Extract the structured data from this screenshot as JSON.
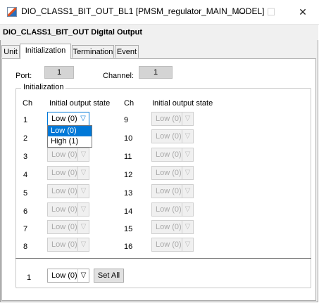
{
  "window": {
    "title": "DIO_CLASS1_BIT_OUT_BL1  [PMSM_regulator_MAIN_MODEL]",
    "controls": {
      "minimize": "—",
      "maximize": "☐",
      "close": "✕"
    }
  },
  "header": {
    "title": "DIO_CLASS1_BIT_OUT  Digital Output"
  },
  "tabs": [
    {
      "label": "Unit"
    },
    {
      "label": "Initialization",
      "active": true
    },
    {
      "label": "Termination"
    },
    {
      "label": "Event"
    }
  ],
  "port": {
    "label": "Port:",
    "value": "1"
  },
  "channel": {
    "label": "Channel:",
    "value": "1"
  },
  "initialization": {
    "legend": "Initialization",
    "col_ch": "Ch",
    "col_state": "Initial output state",
    "rows_left": [
      {
        "ch": "1",
        "state": "Low (0)"
      },
      {
        "ch": "2",
        "state": "Low (0)"
      },
      {
        "ch": "3",
        "state": "Low (0)"
      },
      {
        "ch": "4",
        "state": "Low (0)"
      },
      {
        "ch": "5",
        "state": "Low (0)"
      },
      {
        "ch": "6",
        "state": "Low (0)"
      },
      {
        "ch": "7",
        "state": "Low (0)"
      },
      {
        "ch": "8",
        "state": "Low (0)"
      }
    ],
    "rows_right": [
      {
        "ch": "9",
        "state": "Low (0)"
      },
      {
        "ch": "10",
        "state": "Low (0)"
      },
      {
        "ch": "11",
        "state": "Low (0)"
      },
      {
        "ch": "12",
        "state": "Low (0)"
      },
      {
        "ch": "13",
        "state": "Low (0)"
      },
      {
        "ch": "14",
        "state": "Low (0)"
      },
      {
        "ch": "15",
        "state": "Low (0)"
      },
      {
        "ch": "16",
        "state": "Low (0)"
      }
    ],
    "dropdown_options": [
      "Low (0)",
      "High (1)"
    ]
  },
  "set_all": {
    "ch": "1",
    "state": "Low (0)",
    "button": "Set All"
  },
  "icons": {
    "dropdown_arrow": "chevron-down-icon"
  }
}
